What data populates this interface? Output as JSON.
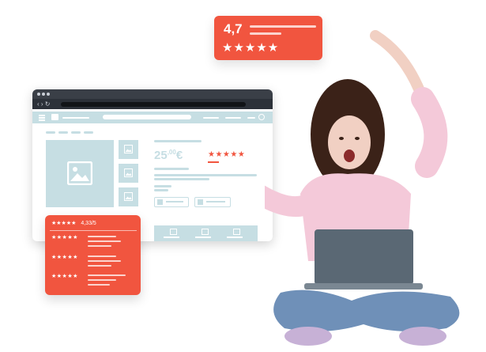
{
  "top_rating": {
    "value": "4,7",
    "stars": "★★★★★"
  },
  "browser": {
    "nav_arrows": "‹ › ↻",
    "price_main": "25",
    "price_cents": ",00",
    "price_currency": "€",
    "product_stars": "★★★★★"
  },
  "review_card": {
    "summary_stars": "★★★★★",
    "summary_score": "4,33/5",
    "rows": [
      {
        "stars": "★★★★★"
      },
      {
        "stars": "★★★★★"
      },
      {
        "stars": "★★★★★"
      }
    ]
  },
  "colors": {
    "accent": "#f1553f",
    "soft_blue": "#c6dee3",
    "dark_chrome": "#2c3139"
  }
}
